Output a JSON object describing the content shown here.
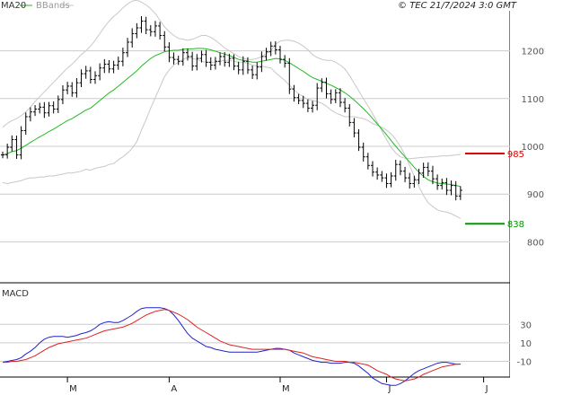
{
  "header": {
    "legend_ma": "MA20",
    "legend_bb": "BBands",
    "copyright": "© TEC 21/7/2024 3:0 GMT"
  },
  "colors": {
    "candle": "#000000",
    "ma": "#22bb22",
    "bands": "#c8c8c8",
    "grid": "#cccccc",
    "resistance": "#dd0000",
    "support": "#009900",
    "macd": "#2222cc",
    "signal": "#dd2222"
  },
  "chart_data": [
    {
      "type": "candlestick",
      "title": "",
      "ylim": [
        720,
        1280
      ],
      "yticks": [
        800,
        900,
        1000,
        1100,
        1200
      ],
      "y_tick_labels": [
        "800",
        "900",
        "1000",
        "1100",
        "1200"
      ],
      "x_month_labels": [
        "M",
        "A",
        "M",
        "J",
        "J"
      ],
      "x_month_index": [
        14,
        36,
        60,
        83,
        104
      ],
      "closes": [
        982,
        998,
        1014,
        982,
        1033,
        1062,
        1072,
        1078,
        1082,
        1070,
        1085,
        1078,
        1098,
        1118,
        1126,
        1112,
        1133,
        1152,
        1158,
        1140,
        1148,
        1164,
        1172,
        1162,
        1170,
        1178,
        1196,
        1218,
        1236,
        1248,
        1262,
        1244,
        1240,
        1252,
        1232,
        1208,
        1186,
        1182,
        1178,
        1196,
        1188,
        1168,
        1184,
        1192,
        1176,
        1170,
        1178,
        1188,
        1176,
        1184,
        1168,
        1160,
        1178,
        1160,
        1150,
        1166,
        1188,
        1198,
        1210,
        1202,
        1182,
        1174,
        1120,
        1102,
        1096,
        1090,
        1080,
        1086,
        1122,
        1134,
        1110,
        1098,
        1112,
        1092,
        1080,
        1050,
        1028,
        998,
        978,
        960,
        946,
        940,
        934,
        922,
        938,
        962,
        948,
        934,
        922,
        930,
        944,
        956,
        948,
        932,
        918,
        924,
        908,
        918,
        896,
        908
      ],
      "ranges": [
        20,
        22,
        25,
        24,
        26,
        25,
        28,
        24,
        26,
        30,
        22,
        26,
        24,
        28,
        26,
        24,
        28,
        26,
        30,
        24,
        26,
        28,
        30,
        24,
        26,
        28,
        30,
        26,
        32,
        28,
        30,
        26,
        28,
        30,
        24,
        26,
        28,
        30,
        22,
        26,
        24,
        28,
        26,
        24,
        28,
        30,
        26,
        24,
        26,
        28,
        24,
        26,
        30,
        24,
        26,
        28,
        30,
        24,
        26,
        28,
        24,
        26,
        30,
        24,
        22,
        28,
        24,
        26,
        30,
        24,
        28,
        26,
        22,
        28,
        26,
        24,
        26,
        22,
        28,
        24,
        26,
        28,
        24,
        26,
        22,
        28,
        24,
        26,
        30,
        24,
        26,
        28,
        30,
        32,
        26,
        24,
        28,
        30,
        26,
        24
      ],
      "ma20": [
        982,
        985,
        989,
        991,
        996,
        1002,
        1008,
        1014,
        1020,
        1025,
        1031,
        1036,
        1042,
        1048,
        1054,
        1058,
        1064,
        1070,
        1076,
        1080,
        1088,
        1096,
        1104,
        1112,
        1118,
        1126,
        1134,
        1142,
        1150,
        1158,
        1168,
        1176,
        1184,
        1190,
        1194,
        1198,
        1200,
        1201,
        1201,
        1203,
        1204,
        1204,
        1205,
        1205,
        1204,
        1202,
        1199,
        1196,
        1193,
        1190,
        1186,
        1182,
        1180,
        1178,
        1176,
        1176,
        1178,
        1180,
        1182,
        1184,
        1183,
        1180,
        1175,
        1169,
        1163,
        1157,
        1150,
        1144,
        1140,
        1136,
        1132,
        1128,
        1123,
        1118,
        1112,
        1105,
        1097,
        1088,
        1079,
        1069,
        1058,
        1047,
        1036,
        1024,
        1012,
        1000,
        989,
        978,
        967,
        956,
        946,
        937,
        930,
        926,
        923,
        922,
        921,
        920,
        918,
        916
      ],
      "bb_upper": [
        1040,
        1048,
        1054,
        1058,
        1064,
        1072,
        1082,
        1094,
        1104,
        1114,
        1124,
        1134,
        1144,
        1154,
        1164,
        1172,
        1182,
        1192,
        1200,
        1210,
        1222,
        1236,
        1250,
        1262,
        1272,
        1280,
        1290,
        1298,
        1304,
        1306,
        1302,
        1296,
        1288,
        1278,
        1264,
        1250,
        1240,
        1232,
        1226,
        1224,
        1222,
        1224,
        1228,
        1232,
        1232,
        1228,
        1222,
        1214,
        1206,
        1200,
        1194,
        1188,
        1184,
        1182,
        1182,
        1184,
        1188,
        1194,
        1200,
        1214,
        1220,
        1222,
        1222,
        1220,
        1216,
        1210,
        1202,
        1192,
        1186,
        1182,
        1180,
        1180,
        1176,
        1170,
        1162,
        1148,
        1132,
        1116,
        1100,
        1084,
        1068,
        1050,
        1032,
        1014,
        998,
        986,
        978,
        975,
        974,
        975,
        976,
        977,
        978,
        978,
        979,
        980,
        980,
        981,
        982,
        983
      ],
      "bb_lower": [
        924,
        922,
        924,
        926,
        928,
        932,
        934,
        934,
        936,
        936,
        938,
        938,
        940,
        942,
        944,
        944,
        946,
        948,
        952,
        950,
        954,
        956,
        958,
        962,
        964,
        972,
        978,
        986,
        996,
        1010,
        1034,
        1056,
        1080,
        1102,
        1124,
        1146,
        1160,
        1170,
        1176,
        1182,
        1186,
        1184,
        1182,
        1178,
        1176,
        1176,
        1176,
        1178,
        1180,
        1180,
        1178,
        1176,
        1176,
        1174,
        1170,
        1168,
        1168,
        1166,
        1164,
        1154,
        1146,
        1138,
        1128,
        1118,
        1110,
        1104,
        1098,
        1096,
        1094,
        1090,
        1084,
        1076,
        1070,
        1066,
        1062,
        1062,
        1062,
        1060,
        1058,
        1054,
        1048,
        1044,
        1040,
        1034,
        1026,
        1014,
        1000,
        981,
        960,
        937,
        916,
        897,
        882,
        874,
        867,
        864,
        862,
        859,
        854,
        849
      ],
      "annotations": [
        {
          "label": "985",
          "value": 985,
          "kind": "resistance"
        },
        {
          "label": "838",
          "value": 838,
          "kind": "support"
        }
      ]
    },
    {
      "type": "line",
      "title": "MACD",
      "ylim": [
        -25,
        70
      ],
      "yticks": [
        30,
        10,
        -10
      ],
      "y_tick_labels": [
        "30",
        "10",
        "-10"
      ],
      "series": [
        {
          "values": [
            -11,
            -10,
            -9,
            -8,
            -6,
            -2,
            1,
            5,
            10,
            14,
            16,
            17,
            17,
            17,
            16,
            17,
            18,
            20,
            21,
            23,
            26,
            30,
            32,
            33,
            32,
            32,
            34,
            37,
            40,
            44,
            47,
            48,
            48,
            48,
            48,
            47,
            45,
            40,
            34,
            27,
            20,
            15,
            12,
            9,
            6,
            5,
            3,
            2,
            1,
            0,
            0,
            0,
            0,
            0,
            0,
            0,
            1,
            2,
            3,
            4,
            4,
            3,
            2,
            -1,
            -3,
            -5,
            -7,
            -9,
            -10,
            -11,
            -11,
            -12,
            -12,
            -12,
            -11,
            -11,
            -12,
            -15,
            -19,
            -23,
            -28,
            -31,
            -34,
            -35,
            -36,
            -36,
            -34,
            -31,
            -27,
            -23,
            -20,
            -18,
            -16,
            -14,
            -12,
            -11,
            -11,
            -12,
            -13,
            -13
          ]
        },
        {
          "values": [
            -11,
            -11,
            -10,
            -10,
            -9,
            -8,
            -6,
            -4,
            -1,
            2,
            5,
            7,
            9,
            10,
            11,
            12,
            13,
            14,
            15,
            17,
            19,
            21,
            23,
            24,
            25,
            26,
            27,
            29,
            31,
            34,
            37,
            40,
            42,
            44,
            45,
            46,
            45,
            43,
            41,
            38,
            35,
            31,
            27,
            24,
            21,
            18,
            15,
            12,
            10,
            8,
            7,
            6,
            5,
            4,
            3,
            3,
            3,
            3,
            3,
            3,
            3,
            3,
            2,
            1,
            0,
            -1,
            -3,
            -5,
            -6,
            -7,
            -8,
            -9,
            -10,
            -10,
            -10,
            -11,
            -11,
            -12,
            -13,
            -14,
            -17,
            -20,
            -22,
            -24,
            -27,
            -29,
            -30,
            -31,
            -30,
            -29,
            -27,
            -24,
            -22,
            -20,
            -18,
            -16,
            -15,
            -14,
            -13,
            -13
          ]
        }
      ]
    }
  ]
}
